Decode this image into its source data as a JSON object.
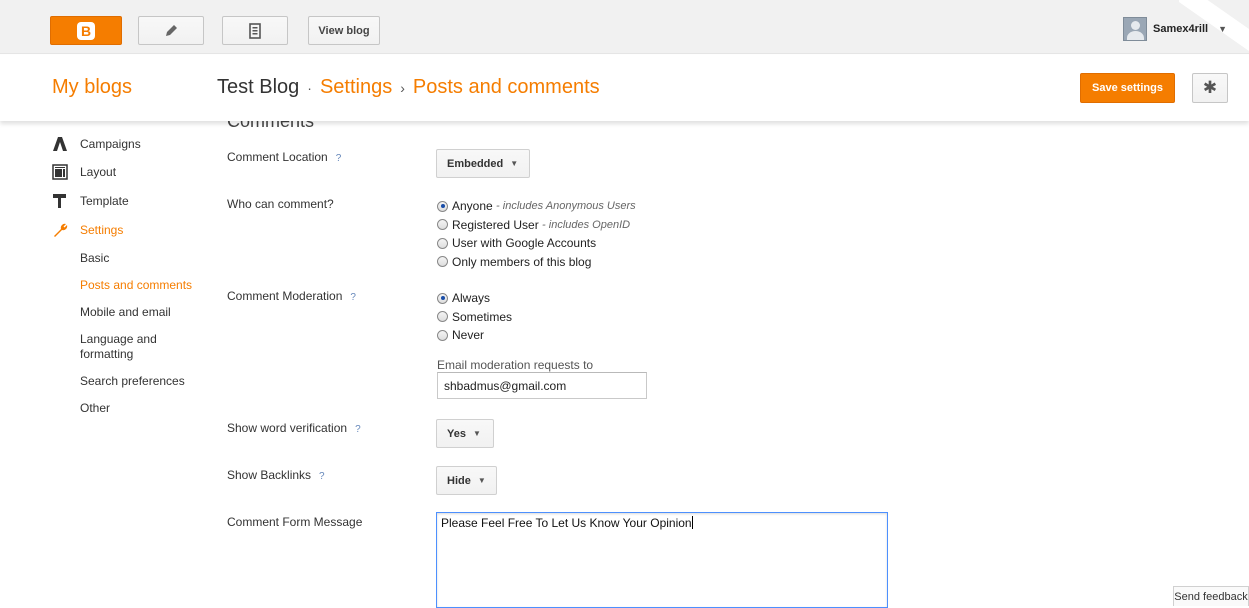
{
  "topbar": {
    "view_blog_label": "View blog",
    "username": "Samex4rill",
    "icons": [
      "blogger-logo-icon",
      "pencil-icon",
      "pages-icon",
      "avatar",
      "chevron-down-icon"
    ],
    "brand_color": "#f57d00"
  },
  "header": {
    "my_blogs": "My blogs",
    "blog_name": "Test Blog",
    "sep1": "·",
    "settings": "Settings",
    "sep2": "›",
    "page": "Posts and comments",
    "save_label": "Save settings",
    "gear_icon": "gear-icon"
  },
  "section": {
    "heading": "Comments"
  },
  "sidebar": {
    "items": [
      {
        "label": "Campaigns",
        "icon": "campaigns-icon"
      },
      {
        "label": "Layout",
        "icon": "layout-icon"
      },
      {
        "label": "Template",
        "icon": "template-icon"
      },
      {
        "label": "Settings",
        "icon": "wrench-icon"
      }
    ],
    "subitems": [
      {
        "label": "Basic"
      },
      {
        "label": "Posts and comments"
      },
      {
        "label": "Mobile and email"
      },
      {
        "label": "Language and formatting"
      },
      {
        "label": "Search preferences"
      },
      {
        "label": "Other"
      }
    ]
  },
  "form": {
    "comment_location": {
      "label": "Comment Location",
      "help": "?",
      "value": "Embedded"
    },
    "who_can_comment": {
      "label": "Who can comment?",
      "options": [
        {
          "label": "Anyone",
          "note": "- includes Anonymous Users",
          "selected": true
        },
        {
          "label": "Registered User",
          "note": "- includes OpenID",
          "selected": false
        },
        {
          "label": "User with Google Accounts",
          "note": "",
          "selected": false
        },
        {
          "label": "Only members of this blog",
          "note": "",
          "selected": false
        }
      ]
    },
    "comment_moderation": {
      "label": "Comment Moderation",
      "help": "?",
      "options": [
        {
          "label": "Always",
          "selected": true
        },
        {
          "label": "Sometimes",
          "selected": false
        },
        {
          "label": "Never",
          "selected": false
        }
      ],
      "email_label": "Email moderation requests to",
      "email_value": "shbadmus@gmail.com"
    },
    "word_verification": {
      "label": "Show word verification",
      "help": "?",
      "value": "Yes"
    },
    "backlinks": {
      "label": "Show Backlinks",
      "help": "?",
      "value": "Hide"
    },
    "comment_form_message": {
      "label": "Comment Form Message",
      "value": "Please Feel Free To Let Us Know Your Opinion"
    }
  },
  "feedback": {
    "label": "Send feedback"
  }
}
